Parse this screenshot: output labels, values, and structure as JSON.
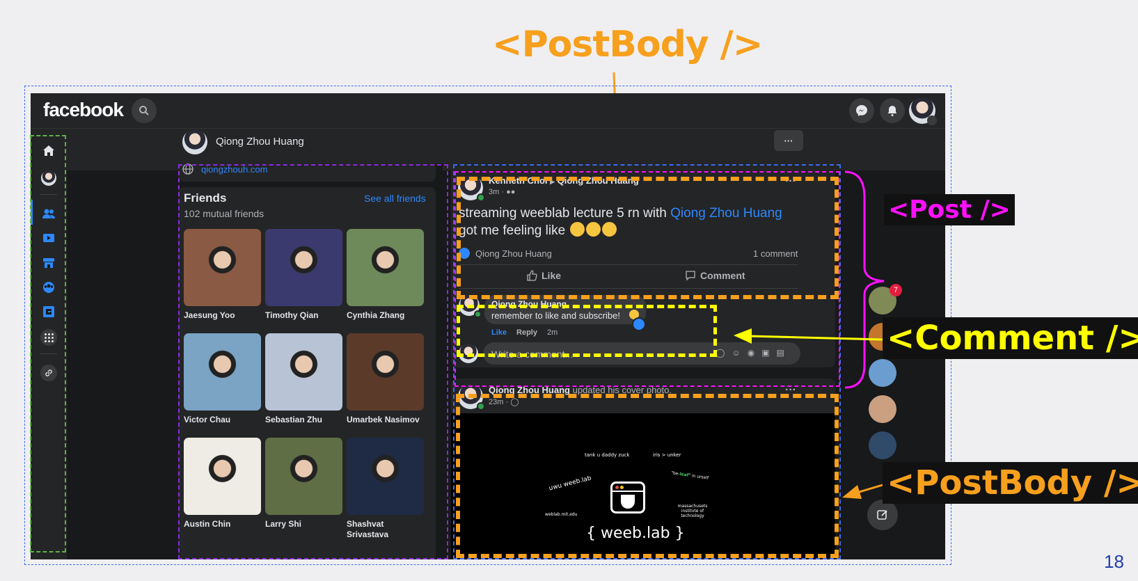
{
  "slide": {
    "title": "<PostBody />",
    "labels": {
      "post": "<Post />",
      "comment": "<Comment />",
      "postbody": "<PostBody />"
    },
    "page_number": "18"
  },
  "app": {
    "logo": "facebook",
    "profile_name": "Qiong Zhou Huang",
    "website": "qiongzhouh.com",
    "more_label": "···"
  },
  "friends": {
    "title": "Friends",
    "subtitle": "102 mutual friends",
    "see_all": "See all friends",
    "list": [
      {
        "name": "Jaesung Yoo",
        "color": "#8a5a45"
      },
      {
        "name": "Timothy Qian",
        "color": "#3b3a6e"
      },
      {
        "name": "Cynthia Zhang",
        "color": "#6f8a5a"
      },
      {
        "name": "Victor Chau",
        "color": "#7aa3c4"
      },
      {
        "name": "Sebastian Zhu",
        "color": "#b9c3d6"
      },
      {
        "name": "Umarbek Nasimov",
        "color": "#5c3a2a"
      },
      {
        "name": "Austin Chin",
        "color": "#efece6"
      },
      {
        "name": "Larry Shi",
        "color": "#5f6e45"
      },
      {
        "name": "Shashvat Srivastava",
        "color": "#1f2a44"
      }
    ]
  },
  "post1": {
    "author": "Kenneth Choi",
    "recipient": "Qiong Zhou Huang",
    "time": "3m ·",
    "text_before": "streaming weeblab lecture 5 rn with ",
    "mention": "Qiong Zhou Huang",
    "text_after": " got me feeling like",
    "liker": "Qiong Zhou Huang",
    "comment_count": "1 comment",
    "like_button": "Like",
    "comment_button": "Comment",
    "comment": {
      "author": "Qiong Zhou Huang",
      "text": "remember to like and subscribe!",
      "like": "Like",
      "reply": "Reply",
      "time": "2m"
    },
    "write_placeholder": "Write a comment..."
  },
  "post2": {
    "author": "Qiong Zhou Huang",
    "action": "updated his cover photo.",
    "time": "23m ·",
    "cover": {
      "t1": "tank u daddy zuck",
      "t2": "iris > unker",
      "t3": "uwu weeb.lab",
      "t4a": "\"be-",
      "t4b": "leaf",
      "t4c": "\" in urself",
      "t5": "weblab.mit.edu",
      "t6": "massachusets institvte of technology",
      "t7": "{ weeb.lab }"
    }
  },
  "contacts": {
    "badge": "7"
  }
}
